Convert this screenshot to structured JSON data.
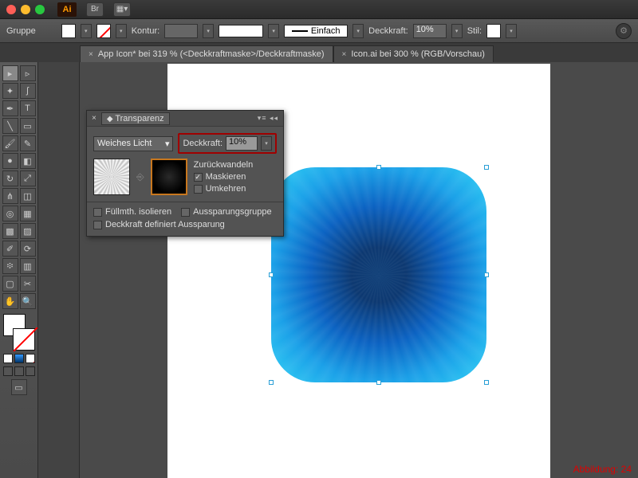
{
  "app": {
    "logo": "Ai",
    "bridge": "Br"
  },
  "controlbar": {
    "group_label": "Gruppe",
    "kontur_label": "Kontur:",
    "stroke_style": "Einfach",
    "deckkraft_label": "Deckkraft:",
    "deckkraft_value": "10%",
    "stil_label": "Stil:"
  },
  "tabs": [
    {
      "label": "App Icon* bei 319 % (<Deckkraftmaske>/Deckkraftmaske)"
    },
    {
      "label": "Icon.ai bei 300 % (RGB/Vorschau)"
    }
  ],
  "panel": {
    "title": "Transparenz",
    "blend_mode": "Weiches Licht",
    "opacity_label": "Deckkraft:",
    "opacity_value": "10%",
    "release": "Zurückwandeln",
    "mask": "Maskieren",
    "invert": "Umkehren",
    "isolate": "Füllmth. isolieren",
    "knockout": "Aussparungsgruppe",
    "opacity_defines": "Deckkraft definiert Aussparung"
  },
  "caption": "Abbildung: 24"
}
